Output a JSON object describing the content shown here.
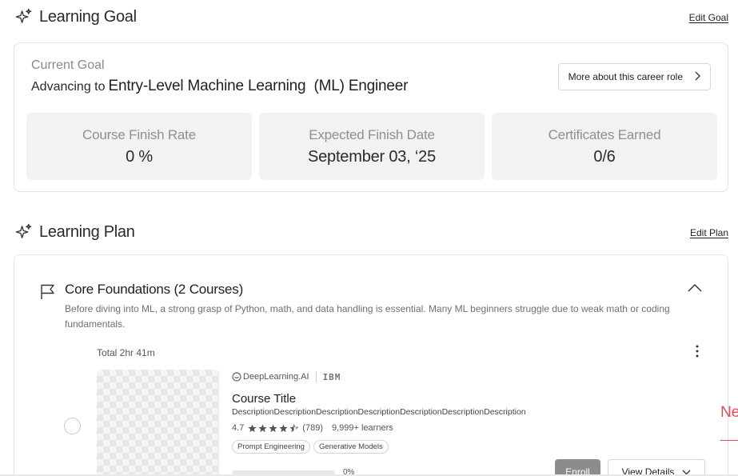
{
  "learning_goal": {
    "title": "Learning Goal",
    "edit_label": "Edit Goal",
    "current_goal_label": "Current Goal",
    "goal_prefix": "Advancing to",
    "goal_role": "Entry-Level Machine Learning  (ML) Engineer",
    "career_button_label": "More about this career role",
    "stats": [
      {
        "label": "Course Finish Rate",
        "value": "0 %"
      },
      {
        "label": "Expected Finish Date",
        "value": "September 03, ‘25"
      },
      {
        "label": "Certificates Earned",
        "value": "0/6"
      }
    ]
  },
  "learning_plan": {
    "title": "Learning Plan",
    "edit_label": "Edit Plan",
    "module": {
      "title": "Core Foundations (2 Courses)",
      "description": "Before diving into ML, a strong grasp of Python, math, and data handling is essential. Many ML beginners struggle due to weak math or coding fundamentals.",
      "total_time": "Total 2hr 41m"
    },
    "course": {
      "provider_1": "DeepLearning.AI",
      "provider_2": "IBM",
      "title": "Course Title",
      "description": "DescriptionDescriptionDescriptionDescriptionDescriptionDescriptionDescription",
      "rating": "4.7",
      "stars": 4.5,
      "reviews": "(789)",
      "learners": "9,999+ learners",
      "tags": [
        "Prompt Engineering",
        "Generative Models"
      ],
      "progress": 0,
      "progress_text": "0%",
      "enroll_label": "Enroll",
      "view_details_label": "View Details"
    }
  },
  "side_badge": "Ne",
  "colors": {
    "accent": "#e8475a",
    "stat_bg": "#f2f2f2",
    "enroll_bg": "#8c8c8c"
  }
}
